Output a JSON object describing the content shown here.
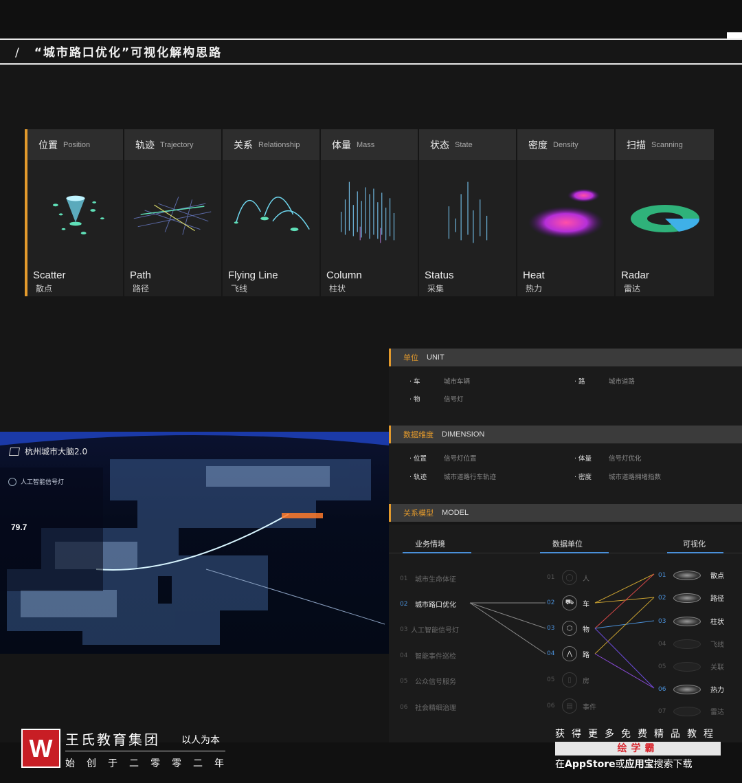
{
  "header": {
    "slash": "/",
    "title": "“城市路口优化”可视化解构思路"
  },
  "cards": [
    {
      "zh": "位置",
      "en": "Position",
      "name_en": "Scatter",
      "name_zh": "散点",
      "icon": "scatter-icon"
    },
    {
      "zh": "轨迹",
      "en": "Trajectory",
      "name_en": "Path",
      "name_zh": "路径",
      "icon": "path-icon"
    },
    {
      "zh": "关系",
      "en": "Relationship",
      "name_en": "Flying Line",
      "name_zh": "飞线",
      "icon": "flying-line-icon"
    },
    {
      "zh": "体量",
      "en": "Mass",
      "name_en": "Column",
      "name_zh": "柱状",
      "icon": "column-icon"
    },
    {
      "zh": "状态",
      "en": "State",
      "name_en": "Status",
      "name_zh": "采集",
      "icon": "status-icon"
    },
    {
      "zh": "密度",
      "en": "Density",
      "name_en": "Heat",
      "name_zh": "热力",
      "icon": "heat-icon"
    },
    {
      "zh": "扫描",
      "en": "Scanning",
      "name_en": "Radar",
      "name_zh": "雷达",
      "icon": "radar-icon"
    }
  ],
  "map": {
    "title": "杭州城市大脑2.0",
    "subtitle": "人工智能信号灯",
    "value": "79.7"
  },
  "unit": {
    "zh": "单位",
    "en": "UNIT",
    "items": [
      {
        "k": "· 车",
        "v": "城市车辆"
      },
      {
        "k": "· 路",
        "v": "城市道路"
      },
      {
        "k": "· 物",
        "v": "信号灯"
      }
    ]
  },
  "dimension": {
    "zh": "数据维度",
    "en": "DIMENSION",
    "items": [
      {
        "k": "· 位置",
        "v": "信号灯位置"
      },
      {
        "k": "· 体量",
        "v": "信号灯优化"
      },
      {
        "k": "· 轨迹",
        "v": "城市道路行车轨迹"
      },
      {
        "k": "· 密度",
        "v": "城市道路拥堵指数"
      }
    ]
  },
  "model": {
    "zh": "关系模型",
    "en": "MODEL",
    "cols": [
      "业务情境",
      "数据单位",
      "可视化"
    ],
    "business": [
      {
        "n": "01",
        "t": "城市生命体征"
      },
      {
        "n": "02",
        "t": "城市路口优化"
      },
      {
        "n": "03",
        "t": "人工智能信号灯"
      },
      {
        "n": "04",
        "t": "智能事件巡检"
      },
      {
        "n": "05",
        "t": "公众信号服务"
      },
      {
        "n": "06",
        "t": "社会精细治理"
      }
    ],
    "units": [
      {
        "n": "01",
        "t": "人",
        "icon": "person-icon"
      },
      {
        "n": "02",
        "t": "车",
        "icon": "car-icon"
      },
      {
        "n": "03",
        "t": "物",
        "icon": "cube-icon"
      },
      {
        "n": "04",
        "t": "路",
        "icon": "road-icon"
      },
      {
        "n": "05",
        "t": "房",
        "icon": "house-icon"
      },
      {
        "n": "06",
        "t": "事件",
        "icon": "event-icon"
      }
    ],
    "vis": [
      {
        "n": "01",
        "t": "散点"
      },
      {
        "n": "02",
        "t": "路径"
      },
      {
        "n": "03",
        "t": "柱状"
      },
      {
        "n": "04",
        "t": "飞线"
      },
      {
        "n": "05",
        "t": "关联"
      },
      {
        "n": "06",
        "t": "热力"
      },
      {
        "n": "07",
        "t": "雷达"
      }
    ]
  },
  "footer": {
    "logo": "W",
    "brand": "王氏教育集团",
    "motto": "以人为本",
    "sub": "始创于二零零二年",
    "promo1": "获得更多免费精品教程",
    "promo_bar": "绘学霸",
    "promo2_a": "在",
    "promo2_b": "AppStore",
    "promo2_c": "或",
    "promo2_d": "应用宝",
    "promo2_e": "搜索下载"
  },
  "colors": {
    "accent": "#e39a2c",
    "blue": "#4a90d9",
    "brand_red": "#c81e25"
  }
}
